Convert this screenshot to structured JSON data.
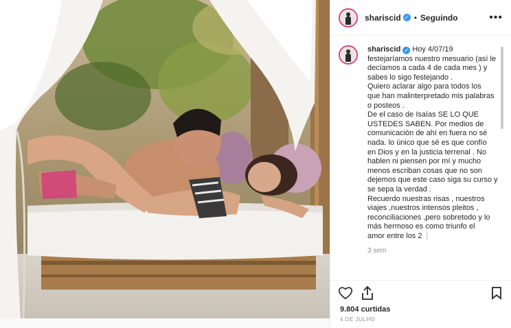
{
  "header": {
    "username": "shariscid",
    "verified": "verified-badge",
    "separator": "•",
    "follow_status": "Seguindo",
    "more_label": "•••"
  },
  "caption": {
    "username": "shariscid",
    "date": "Hoy 4/07/19",
    "lines": [
      "festejaríamos nuestro mesuario (así le",
      "decíamos a cada 4 de cada mes ) y",
      "sabes lo sigo festejando .",
      "Quiero aclarar algo para todos los",
      "que han malinterpretado mis palabras",
      "o posteos .",
      "De el caso de Isaías SE LO QUE",
      "USTEDES SABEN. Por medios de",
      "comunicación de ahí en fuera no sé",
      "nada. lo único que sé es que confío",
      "en Dios y en la justicia terrenal . No",
      "hablen ni piensen por mí y mucho",
      "menos escriban cosas que no son",
      "dejemos que este caso siga su curso y",
      "se sepa la verdad .",
      "Recuerdo nuestras risas , nuestros",
      "viajes ,nuestros intensos pleitos ,",
      "reconciliaciones ,pero sobretodo y lo",
      "más hermoso es como triunfo el",
      "amor entre los 2❕"
    ],
    "time_ago": "3 sem"
  },
  "actions": {
    "likes": "9.804 curtidas",
    "posted_date": "4 DE JULHO"
  },
  "colors": {
    "accent": "#3897f0",
    "story_ring": "#d4437f",
    "muted": "#8e8e8e"
  }
}
